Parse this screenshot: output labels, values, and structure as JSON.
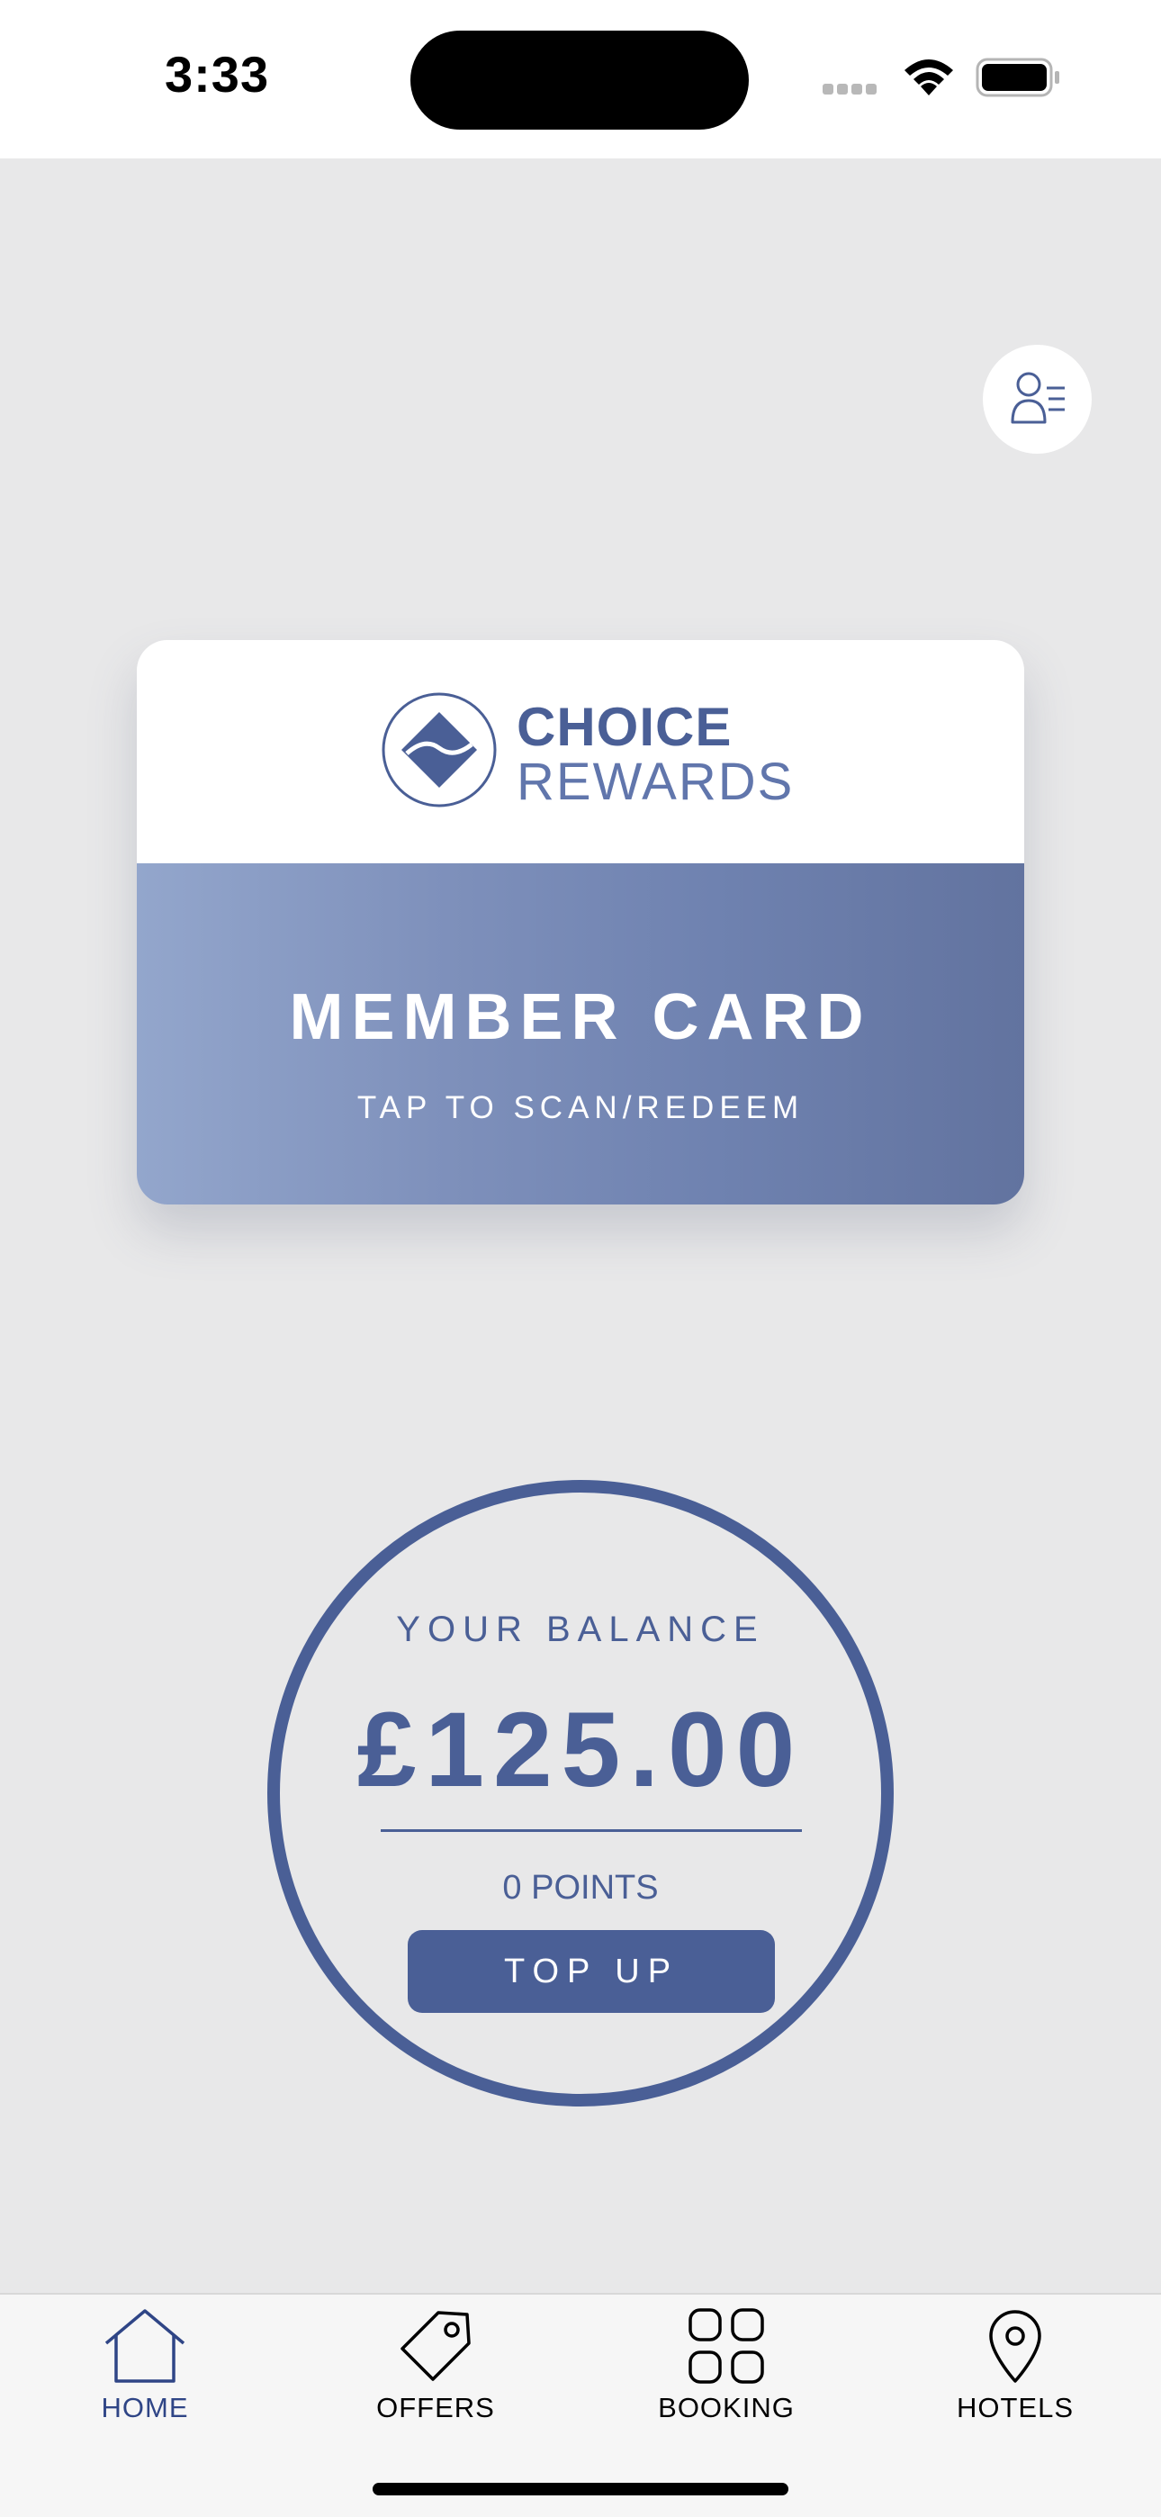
{
  "status_bar": {
    "time": "3:33"
  },
  "colors": {
    "brand": "#4a5f96",
    "background": "#e8e8e9",
    "card_gradient_start": "#93a6cc",
    "card_gradient_end": "#62739f"
  },
  "icons": {
    "profile": "profile-list-icon",
    "brand_logo": "wave-diamond-logo",
    "home": "home-icon",
    "offers": "tag-icon",
    "booking": "grid-icon",
    "hotels": "map-pin-icon"
  },
  "card": {
    "brand_line1": "CHOICE",
    "brand_line2": "REWARDS",
    "title": "MEMBER CARD",
    "subtitle": "TAP TO SCAN/REDEEM"
  },
  "balance": {
    "label": "YOUR BALANCE",
    "amount": "£125.00",
    "points": "0 POINTS",
    "topup_label": "TOP UP"
  },
  "tabs": [
    {
      "label": "HOME",
      "active": true
    },
    {
      "label": "OFFERS",
      "active": false
    },
    {
      "label": "BOOKING",
      "active": false
    },
    {
      "label": "HOTELS",
      "active": false
    }
  ]
}
